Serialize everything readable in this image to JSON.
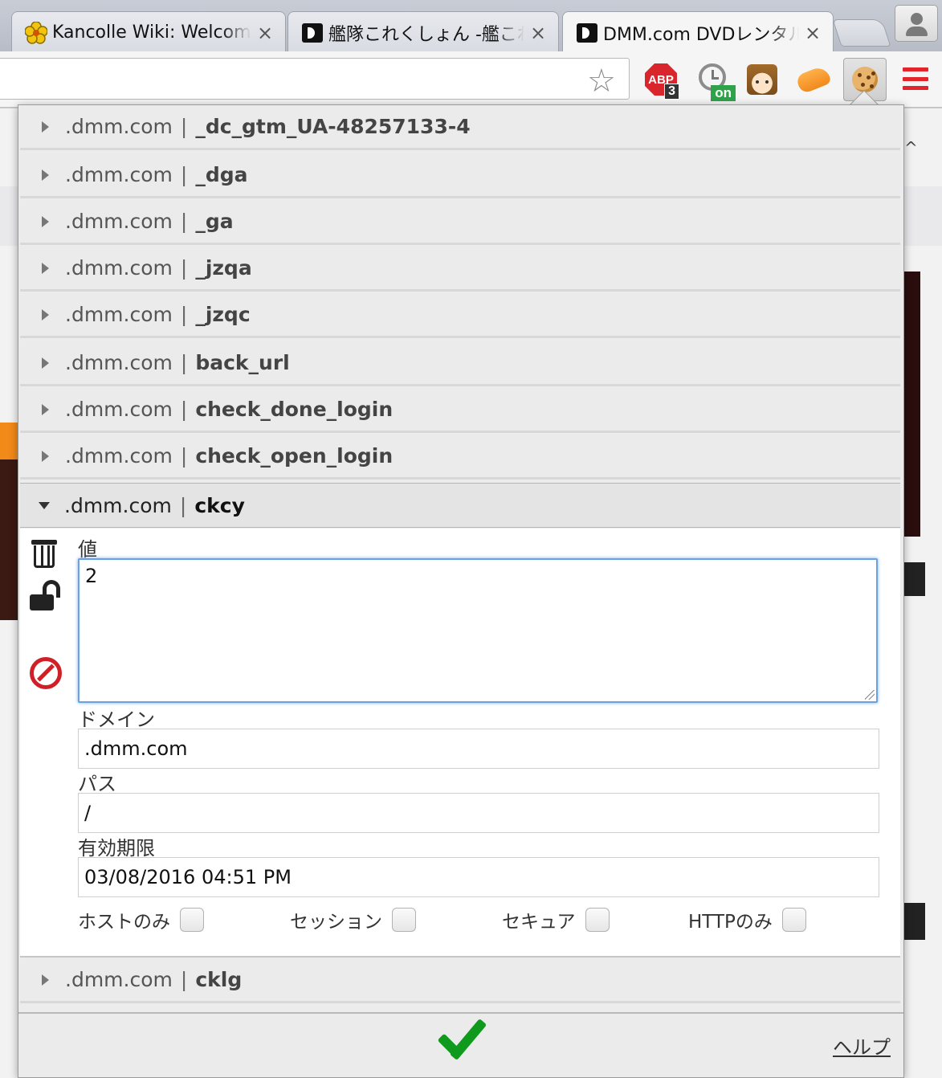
{
  "tabs": [
    {
      "title": "Kancolle Wiki: Welcome",
      "close": "×",
      "favicon": "kancolle-flower-icon",
      "active": false
    },
    {
      "title": "艦隊これくしょん -艦これ",
      "close": "×",
      "favicon": "dmm-d-icon",
      "active": false
    },
    {
      "title": "DMM.com DVDレンタル",
      "close": "×",
      "favicon": "dmm-d-icon",
      "active": true
    }
  ],
  "toolbar": {
    "abp_label": "ABP",
    "abp_badge": "3",
    "timer_badge": "on"
  },
  "cookies": [
    {
      "domain": ".dmm.com",
      "sep": "|",
      "name": "_dc_gtm_UA-48257133-4"
    },
    {
      "domain": ".dmm.com",
      "sep": "|",
      "name": "_dga"
    },
    {
      "domain": ".dmm.com",
      "sep": "|",
      "name": "_ga"
    },
    {
      "domain": ".dmm.com",
      "sep": "|",
      "name": "_jzqa"
    },
    {
      "domain": ".dmm.com",
      "sep": "|",
      "name": "_jzqc"
    },
    {
      "domain": ".dmm.com",
      "sep": "|",
      "name": "back_url"
    },
    {
      "domain": ".dmm.com",
      "sep": "|",
      "name": "check_done_login"
    },
    {
      "domain": ".dmm.com",
      "sep": "|",
      "name": "check_open_login"
    },
    {
      "domain": ".dmm.com",
      "sep": "|",
      "name": "ckcy"
    },
    {
      "domain": ".dmm.com",
      "sep": "|",
      "name": "cklg"
    }
  ],
  "detail": {
    "value_label": "値",
    "value": "2",
    "domain_label": "ドメイン",
    "domain": ".dmm.com",
    "path_label": "パス",
    "path": "/",
    "expires_label": "有効期限",
    "expires": "03/08/2016 04:51 PM",
    "host_only_label": "ホストのみ",
    "session_label": "セッション",
    "secure_label": "セキュア",
    "http_only_label": "HTTPのみ"
  },
  "footer": {
    "help_label": "ヘルプ"
  },
  "colors": {
    "accent_focus": "#6aa1e0",
    "submit_green": "#0f9a1d",
    "block_red": "#d01f26",
    "menu_red": "#e3242b"
  }
}
